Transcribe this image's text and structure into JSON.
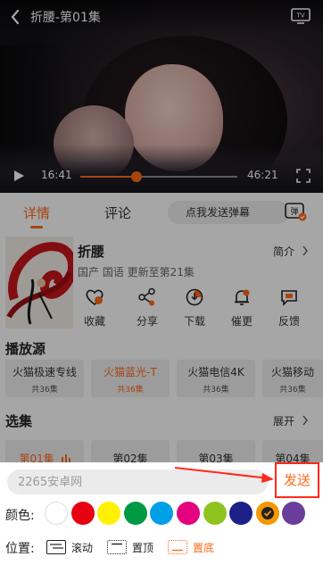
{
  "player": {
    "title": "折腰-第01集",
    "current_time": "16:41",
    "duration": "46:21",
    "progress_fraction": 0.36,
    "icons": {
      "back": "chevron-left-icon",
      "tv": "tv-cast-icon",
      "play": "play-icon",
      "fullscreen": "fullscreen-icon"
    }
  },
  "tabs": {
    "details": "详情",
    "comments": "评论",
    "danmu_placeholder": "点我发送弹幕",
    "danmu_icon": "danmu-toggle-icon"
  },
  "show": {
    "title": "折腰",
    "intro_label": "简介",
    "meta": "国产 国语 更新至第21集",
    "actions": [
      {
        "label": "收藏",
        "icon": "heart-icon"
      },
      {
        "label": "分享",
        "icon": "share-icon"
      },
      {
        "label": "下载",
        "icon": "download-icon"
      },
      {
        "label": "催更",
        "icon": "bell-icon"
      },
      {
        "label": "反馈",
        "icon": "feedback-icon"
      }
    ]
  },
  "sources": {
    "title": "播放源",
    "items": [
      {
        "name": "火猫极速专线",
        "count": "共36集",
        "selected": false
      },
      {
        "name": "火猫蓝光-T",
        "count": "共36集",
        "selected": true
      },
      {
        "name": "火猫电信4K",
        "count": "共36集",
        "selected": false
      },
      {
        "name": "火猫移动",
        "count": "共36集",
        "selected": false
      }
    ]
  },
  "episodes": {
    "title": "选集",
    "expand_label": "展开",
    "items": [
      {
        "label": "第01集",
        "selected": true
      },
      {
        "label": "第02集",
        "selected": false
      },
      {
        "label": "第03集",
        "selected": false
      },
      {
        "label": "第04集",
        "selected": false
      }
    ]
  },
  "danmu_panel": {
    "input_placeholder": "2265安卓网",
    "send_label": "发送",
    "color_label": "颜色:",
    "colors": [
      "#ffffff",
      "#e60012",
      "#fff100",
      "#009944",
      "#00a0e9",
      "#e4007f",
      "#8fc31f",
      "#1d2088",
      "#f39800",
      "#6a3d9a"
    ],
    "selected_color_index": 8,
    "position_label": "位置:",
    "positions": [
      {
        "label": "滚动",
        "selected": false
      },
      {
        "label": "置顶",
        "selected": false
      },
      {
        "label": "置底",
        "selected": true
      }
    ]
  },
  "accent_color": "#ff6a1a",
  "annotation_color": "#ff2a1a"
}
